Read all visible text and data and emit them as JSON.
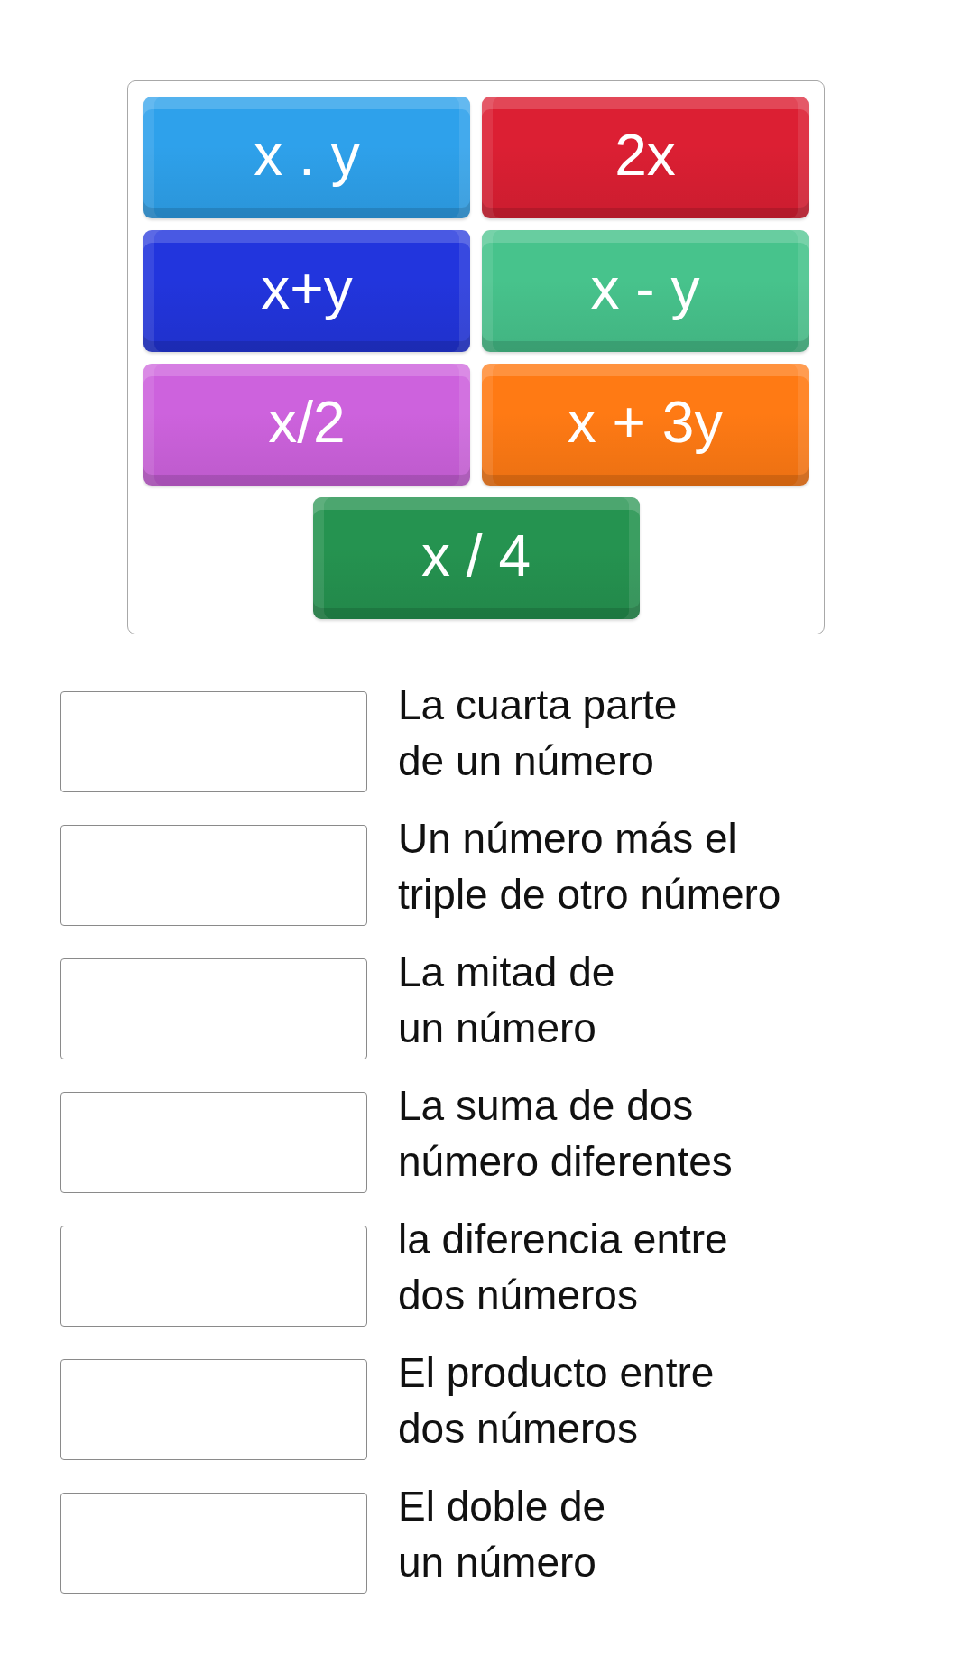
{
  "tiles": [
    {
      "label": "x . y",
      "color": "#2ea1eb"
    },
    {
      "label": "2x",
      "color": "#dc1f33"
    },
    {
      "label": "x+y",
      "color": "#2235dd"
    },
    {
      "label": "x - y",
      "color": "#47c38c"
    },
    {
      "label": "x/2",
      "color": "#cd62dd"
    },
    {
      "label": "x + 3y",
      "color": "#ff7a14"
    },
    {
      "label": "x / 4",
      "color": "#259350"
    }
  ],
  "answers": [
    {
      "lines": [
        "La cuarta parte",
        "de un número"
      ]
    },
    {
      "lines": [
        "Un número más el",
        "triple de otro número"
      ]
    },
    {
      "lines": [
        "La mitad de",
        "un número"
      ]
    },
    {
      "lines": [
        "La suma de dos",
        "número diferentes"
      ]
    },
    {
      "lines": [
        "la diferencia entre",
        "dos números"
      ]
    },
    {
      "lines": [
        "El producto entre",
        "dos números"
      ]
    },
    {
      "lines": [
        "El doble de",
        "un número"
      ]
    }
  ]
}
